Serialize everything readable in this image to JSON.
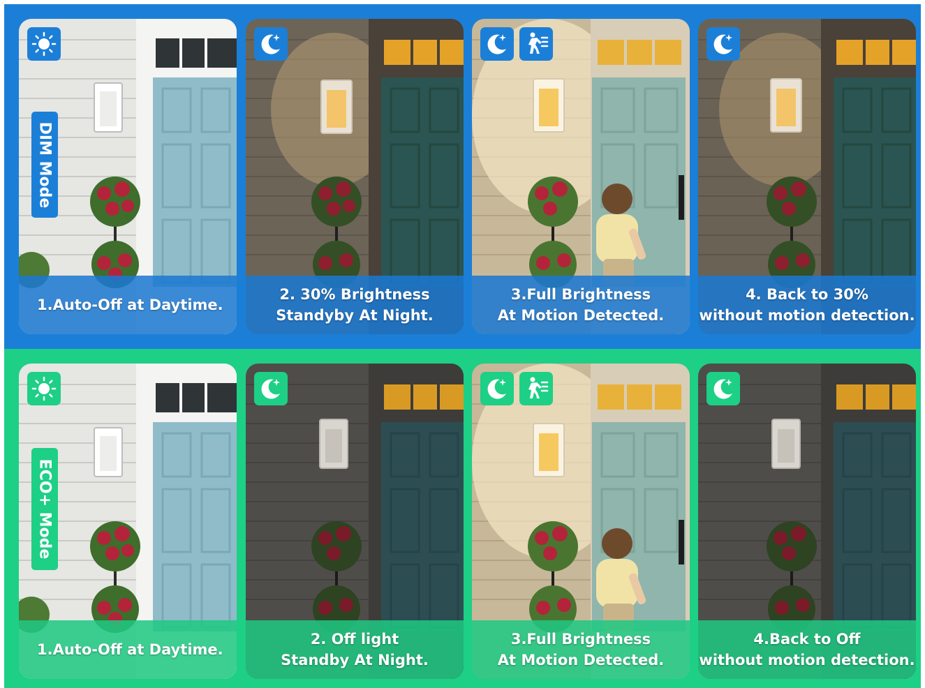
{
  "sections": [
    {
      "mode_label": "DIM Mode",
      "panels": [
        {
          "caption_line1": "1.Auto-Off at Daytime.",
          "caption_line2": "",
          "icons": [
            "sun-icon"
          ]
        },
        {
          "caption_line1": "2. 30% Brightness",
          "caption_line2": "Standyby At Night.",
          "icons": [
            "moon-icon"
          ]
        },
        {
          "caption_line1": "3.Full Brightness",
          "caption_line2": "At  Motion Detected.",
          "icons": [
            "moon-icon",
            "motion-sensor-icon"
          ]
        },
        {
          "caption_line1": "4. Back to 30%",
          "caption_line2": "without motion detection.",
          "icons": [
            "moon-icon"
          ]
        }
      ]
    },
    {
      "mode_label": "ECO+ Mode",
      "panels": [
        {
          "caption_line1": "1.Auto-Off at Daytime.",
          "caption_line2": "",
          "icons": [
            "sun-icon"
          ]
        },
        {
          "caption_line1": "2. Off light",
          "caption_line2": "Standby At Night.",
          "icons": [
            "moon-icon"
          ]
        },
        {
          "caption_line1": "3.Full Brightness",
          "caption_line2": "At  Motion Detected.",
          "icons": [
            "moon-icon",
            "motion-sensor-icon"
          ]
        },
        {
          "caption_line1": "4.Back to Off",
          "caption_line2": "without motion detection.",
          "icons": [
            "moon-icon"
          ]
        }
      ]
    }
  ],
  "colors": {
    "dim_blue": "#1b7fd8",
    "eco_green": "#1ecf86",
    "siding_day": "#e8e8e6",
    "door_day": "#8fbcc8",
    "door_night": "#2b5552",
    "lamp_glow": "#f3c46a",
    "transom_glow": "#f0a92a",
    "flowers": "#b3243a",
    "foliage": "#3f6d2c",
    "child_shirt": "#f1e3a6"
  }
}
